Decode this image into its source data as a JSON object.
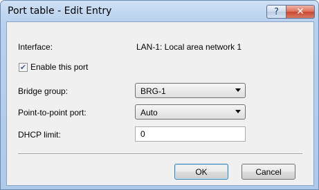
{
  "window": {
    "title": "Port table - Edit Entry",
    "help_glyph": "?",
    "close_glyph": "✕"
  },
  "form": {
    "interface_label": "Interface:",
    "interface_value": "LAN-1: Local area network 1",
    "enable_port_label": "Enable this port",
    "enable_port_checked": true,
    "check_glyph": "✔",
    "bridge_group_label": "Bridge group:",
    "bridge_group_value": "BRG-1",
    "p2p_label": "Point-to-point port:",
    "p2p_value": "Auto",
    "dhcp_limit_label": "DHCP limit:",
    "dhcp_limit_value": "0"
  },
  "buttons": {
    "ok_label": "OK",
    "cancel_label": "Cancel"
  }
}
